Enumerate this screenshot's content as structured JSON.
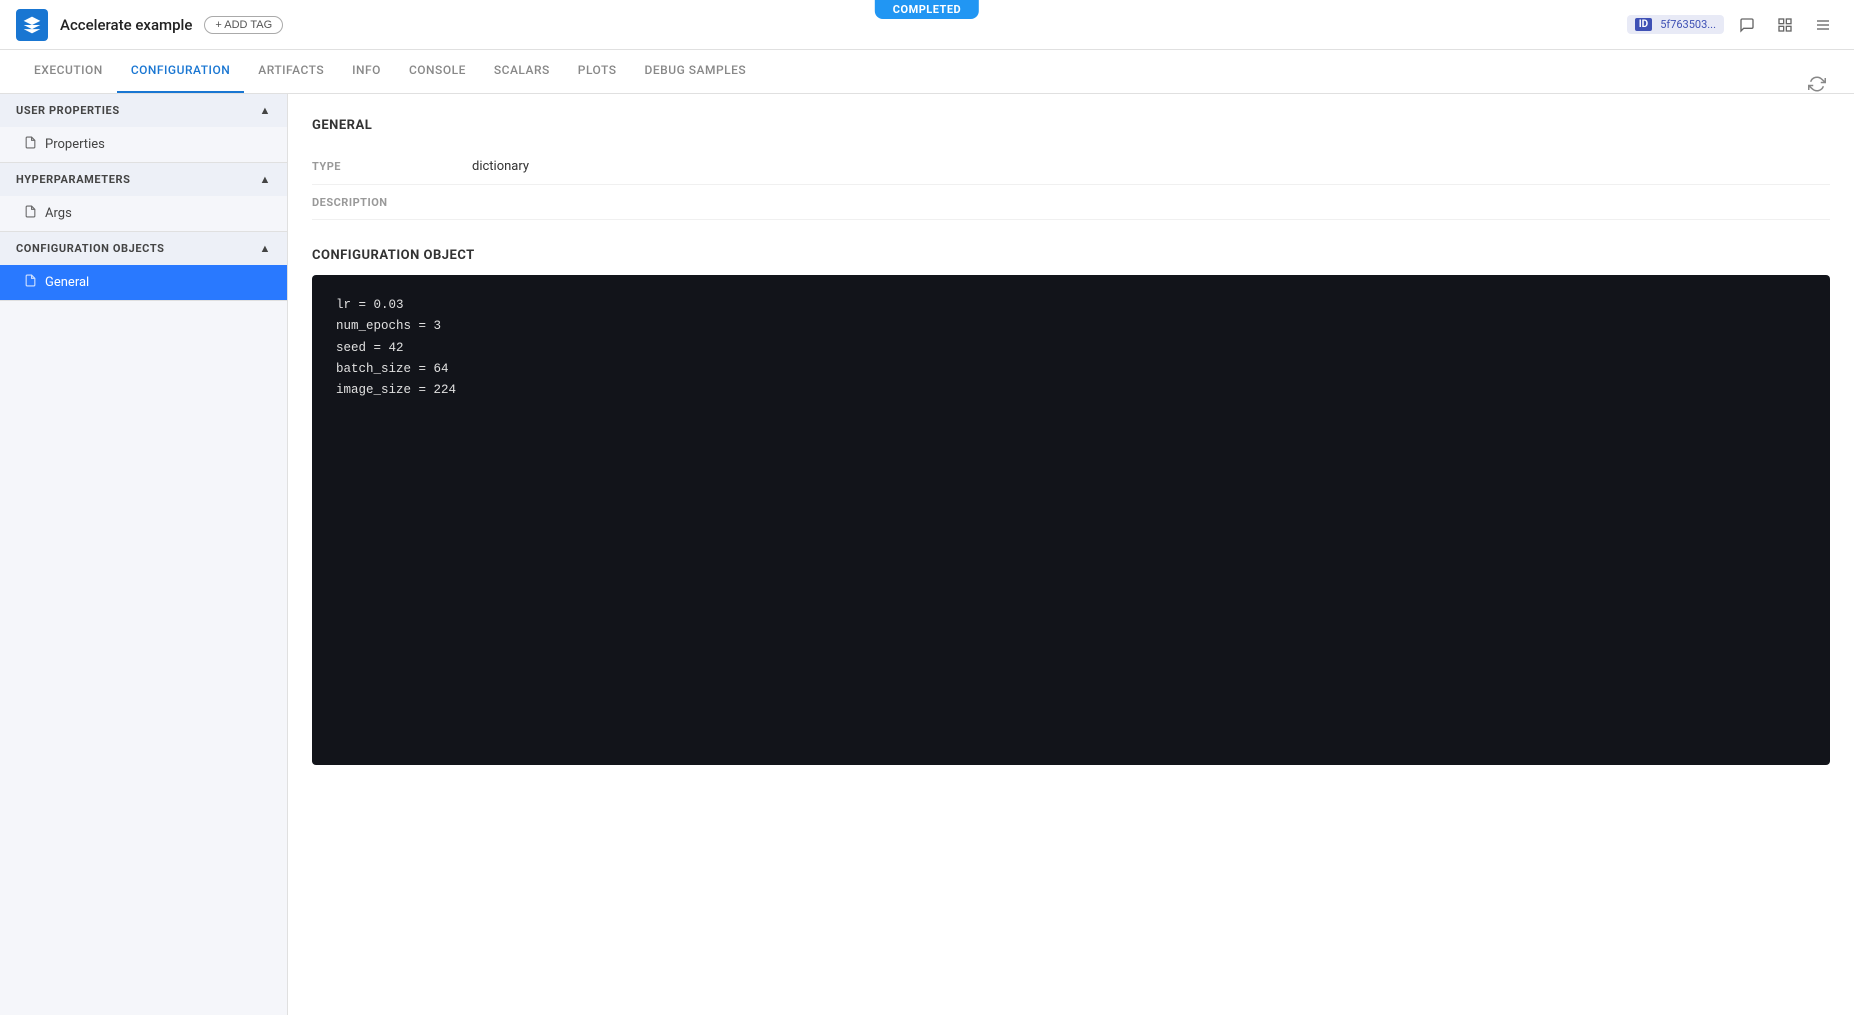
{
  "header": {
    "app_title": "Accelerate example",
    "add_tag_label": "+ ADD TAG",
    "completed_badge": "COMPLETED",
    "id_label": "ID",
    "id_value": "5f763503...",
    "icons": {
      "comment": "💬",
      "layout": "⊞",
      "menu": "≡"
    }
  },
  "tabs": [
    {
      "id": "execution",
      "label": "EXECUTION",
      "active": false
    },
    {
      "id": "configuration",
      "label": "CONFIGURATION",
      "active": true
    },
    {
      "id": "artifacts",
      "label": "ARTIFACTS",
      "active": false
    },
    {
      "id": "info",
      "label": "INFO",
      "active": false
    },
    {
      "id": "console",
      "label": "CONSOLE",
      "active": false
    },
    {
      "id": "scalars",
      "label": "SCALARS",
      "active": false
    },
    {
      "id": "plots",
      "label": "PLOTS",
      "active": false
    },
    {
      "id": "debug_samples",
      "label": "DEBUG SAMPLES",
      "active": false
    }
  ],
  "sidebar": {
    "sections": [
      {
        "id": "user-properties",
        "label": "USER PROPERTIES",
        "expanded": true,
        "items": [
          {
            "id": "properties",
            "label": "Properties",
            "active": false
          }
        ]
      },
      {
        "id": "hyperparameters",
        "label": "HYPERPARAMETERS",
        "expanded": true,
        "items": [
          {
            "id": "args",
            "label": "Args",
            "active": false
          }
        ]
      },
      {
        "id": "configuration-objects",
        "label": "CONFIGURATION OBJECTS",
        "expanded": true,
        "items": [
          {
            "id": "general",
            "label": "General",
            "active": true
          }
        ]
      }
    ]
  },
  "main": {
    "general_title": "GENERAL",
    "type_label": "TYPE",
    "type_value": "dictionary",
    "description_label": "DESCRIPTION",
    "description_value": "",
    "config_object_title": "CONFIGURATION OBJECT",
    "code_lines": [
      "lr = 0.03",
      "num_epochs = 3",
      "seed = 42",
      "batch_size = 64",
      "image_size = 224"
    ]
  }
}
